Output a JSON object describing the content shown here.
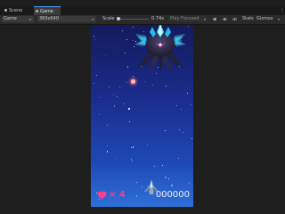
{
  "tabs": [
    {
      "label": "Scene"
    },
    {
      "label": "Game"
    }
  ],
  "toolbar": {
    "display": "Game",
    "resolution": "360x640",
    "scale_label": "Scale",
    "scale_value": "0.74x",
    "play_mode": "Play Focused",
    "stats_label": "Stats",
    "gizmos_label": "Gizmos"
  },
  "hud": {
    "lives_text": "× 4",
    "score": "000000"
  },
  "colors": {
    "heart": "#ff3d8a",
    "bullet_glow": "#ff6a6a",
    "boss_accent": "#38d6ff",
    "boss_body": "#2b2847"
  }
}
